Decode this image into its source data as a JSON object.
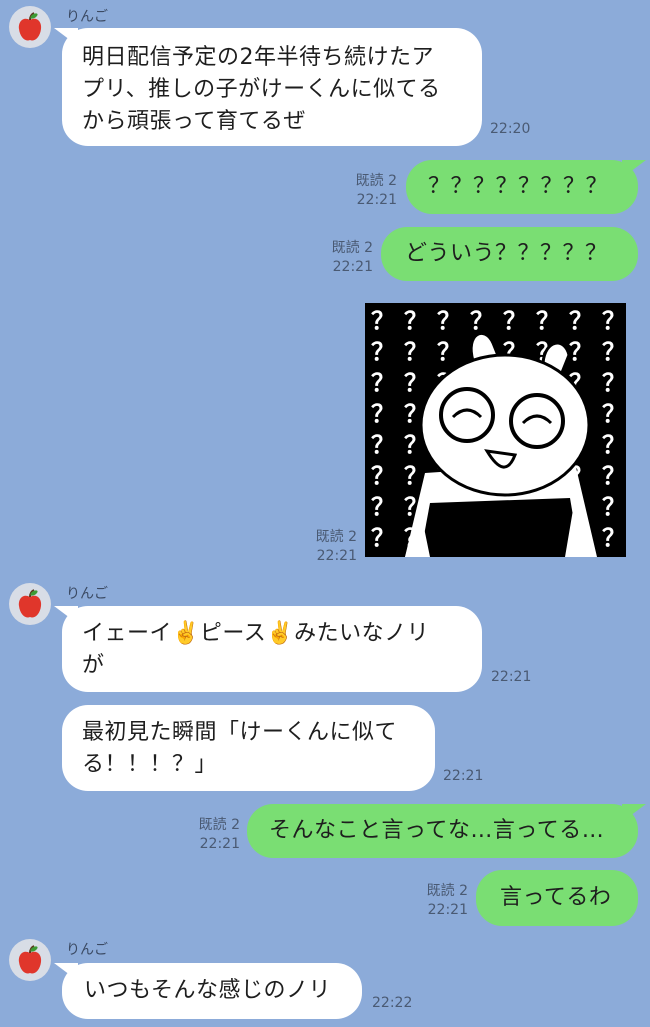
{
  "contact": {
    "name": "りんご",
    "avatar_icon": "apple-icon"
  },
  "messages": [
    {
      "text": "明日配信予定の2年半待ち続けたア\nプリ、推しの子がけーくんに似てる\nから頑張って育てるぜ",
      "time": "22:20"
    },
    {
      "text": "？？？？？？？？",
      "read": "既読 2",
      "time": "22:21"
    },
    {
      "text": "どういう？？？？？",
      "read": "既読 2",
      "time": "22:21"
    },
    {
      "sticker": "sticker-image",
      "sticker_text": "？",
      "read": "既読 2",
      "time": "22:21"
    },
    {
      "text": "イェーイ✌️ピース✌️みたいなノリ\nが",
      "time": "22:21"
    },
    {
      "text": "最初見た瞬間「けーくんに似て\nる！！！？」",
      "time": "22:21"
    },
    {
      "text": "そんなこと言ってな…言ってる…",
      "read": "既読 2",
      "time": "22:21"
    },
    {
      "text": "言ってるわ",
      "read": "既読 2",
      "time": "22:21"
    },
    {
      "text": "いつもそんな感じのノリ",
      "time": "22:22"
    }
  ],
  "colors": {
    "background": "#8cabd9",
    "incoming": "#ffffff",
    "outgoing": "#7ade73",
    "apple": "#e0362b"
  }
}
